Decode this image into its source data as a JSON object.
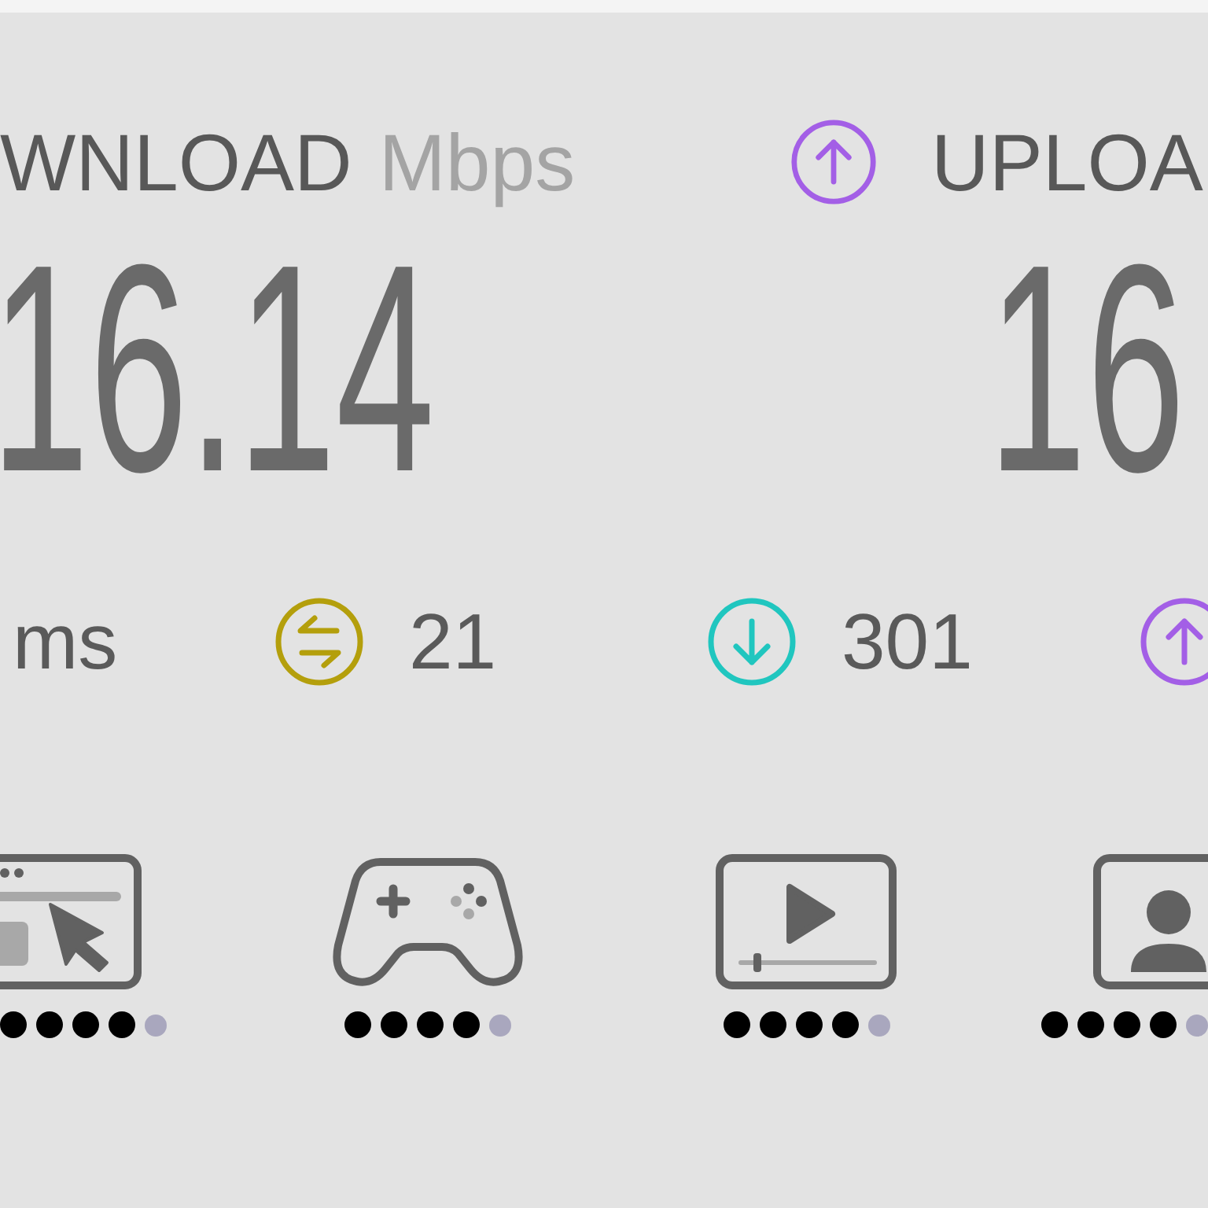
{
  "download": {
    "label": "WNLOAD",
    "unit": "Mbps",
    "value": "16.14"
  },
  "upload": {
    "label": "UPLOA",
    "value": "16"
  },
  "ping": {
    "unit": "ms"
  },
  "latency": [
    {
      "kind": "idle",
      "value": "21"
    },
    {
      "kind": "download",
      "value": "301"
    },
    {
      "kind": "upload"
    }
  ],
  "ratings": [
    {
      "kind": "browsing",
      "stars": 4
    },
    {
      "kind": "gaming",
      "stars": 4
    },
    {
      "kind": "streaming",
      "stars": 4
    },
    {
      "kind": "video-call",
      "stars": 4
    }
  ]
}
